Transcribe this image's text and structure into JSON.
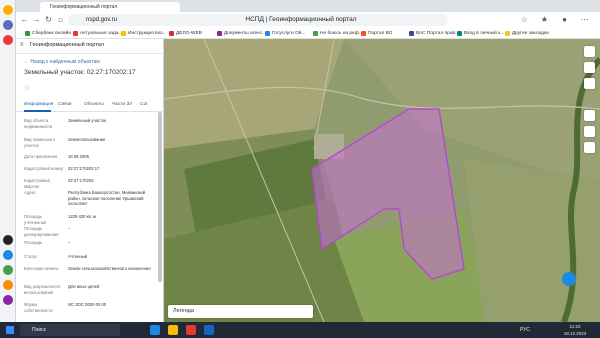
{
  "browser": {
    "tab_title": "Геоинформационный портал",
    "url": "nspd.gov.ru",
    "window_title": "НСПД | Геоинформационный портал"
  },
  "bookmarks": [
    {
      "label": "Сбербанк онлайн",
      "color": "#21a038"
    },
    {
      "label": "Актуальные зада...",
      "color": "#e53935"
    },
    {
      "label": "Инструкция вхо...",
      "color": "#fbbc04"
    },
    {
      "label": "ДЕЛО-WEB",
      "color": "#d32f2f"
    },
    {
      "label": "Документы агенс...",
      "color": "#8e24aa"
    },
    {
      "label": "Госуслуги Ой...",
      "color": "#1e88e5"
    },
    {
      "label": "Не боюсь на реф...",
      "color": "#43a047"
    },
    {
      "label": "Портал ВО",
      "color": "#f4511e"
    },
    {
      "label": "ВАС Портал прав...",
      "color": "#3949ab"
    },
    {
      "label": "Вход в личный к...",
      "color": "#00897b"
    },
    {
      "label": "Другие закладки",
      "color": "#fbc02d"
    }
  ],
  "panel": {
    "title": "Геоинформационный портал",
    "back_link": "← Назад к найденным объектам",
    "object_title": "Земельный участок: 02:27:170202:17",
    "tabs": [
      "Информация",
      "Связи",
      "Объекты",
      "Части ЗУ",
      "Сог"
    ],
    "rows": [
      {
        "label": "Вид объекта недвижимости",
        "value": "Земельный участок"
      },
      {
        "label": "Вид земельного участка",
        "value": "Землепользование"
      },
      {
        "label": "Дата присвоения",
        "value": "18.08.2005"
      },
      {
        "label": "Кадастровый номер",
        "value": "02:27:170202:17"
      },
      {
        "label": "Кадастровый квартал",
        "value": "02:27:170202"
      },
      {
        "label": "Адрес",
        "value": "Республика Башкортостан, Миякинский район, сельское поселение Уршакский сельсовет"
      },
      {
        "label": "Площадь уточненная",
        "value": "1229 430 кв. м"
      },
      {
        "label": "Площадь декларированная",
        "value": "–"
      },
      {
        "label": "Площадь",
        "value": "–"
      },
      {
        "label": "Статус",
        "value": "Учтенный"
      },
      {
        "label": "Категория земель",
        "value": "Земли сельскохозяйственного назначения"
      },
      {
        "label": "Вид разрешенного использования",
        "value": "Для иных целей"
      },
      {
        "label": "Форма собственности",
        "value": "ИС ЗОС 0000 00 00"
      }
    ]
  },
  "map": {
    "legend_label": "Легенда",
    "parcel_color": "#c86ed6",
    "bg_color": "#8e9a6d"
  },
  "taskbar": {
    "search_label": "Поиск",
    "weather": "-4°C Пасмурно",
    "language": "РУС",
    "time": "11:22",
    "date": "18.12.2023"
  }
}
